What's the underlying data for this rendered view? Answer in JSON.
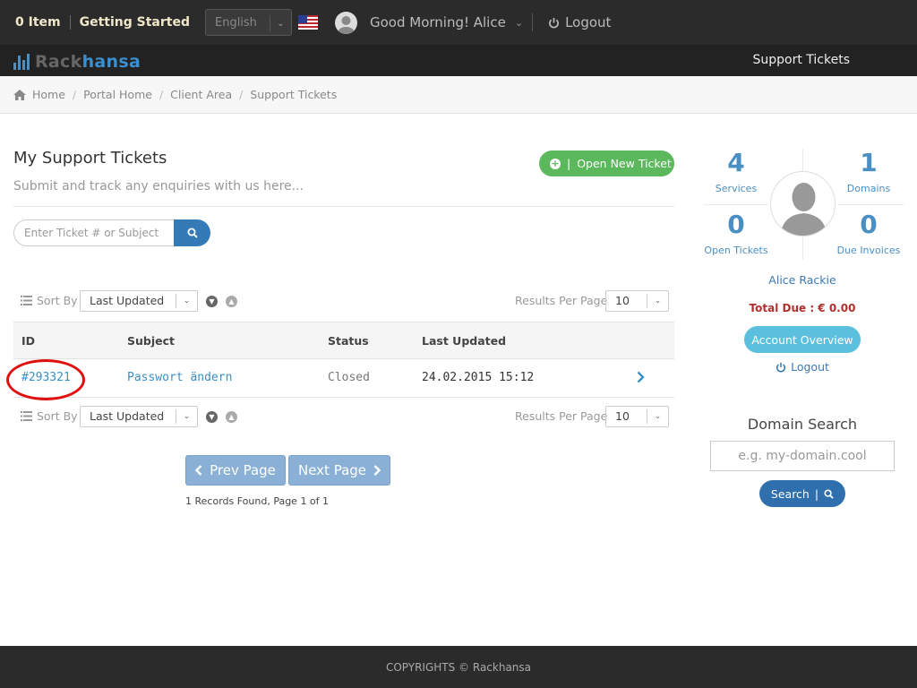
{
  "topbar": {
    "cart": "0 Item",
    "getting_started": "Getting Started",
    "language": "English",
    "greeting": "Good Morning! Alice",
    "logout": "Logout"
  },
  "brand": {
    "logo_part1": "Rack",
    "logo_part2": "hansa",
    "nav_active": "Support Tickets"
  },
  "breadcrumb": [
    "Home",
    "Portal Home",
    "Client Area",
    "Support Tickets"
  ],
  "main": {
    "title": "My Support Tickets",
    "subtitle": "Submit and track any enquiries with us here...",
    "open_ticket_label": "Open New Ticket",
    "search_placeholder": "Enter Ticket # or Subject",
    "sort_by_label": "Sort By",
    "sort_value": "Last Updated",
    "results_per_page_label": "Results Per Page",
    "results_per_page_value": "10",
    "columns": [
      "ID",
      "Subject",
      "Status",
      "Last Updated"
    ],
    "tickets": [
      {
        "id": "#293321",
        "subject": "Passwort ändern",
        "status": "Closed",
        "last_updated": "24.02.2015 15:12"
      }
    ],
    "prev_page": "Prev Page",
    "next_page": "Next Page",
    "records_text": "1 Records Found, Page 1 of 1"
  },
  "sidebar": {
    "stats": [
      {
        "value": "4",
        "label": "Services"
      },
      {
        "value": "1",
        "label": "Domains"
      },
      {
        "value": "0",
        "label": "Open Tickets"
      },
      {
        "value": "0",
        "label": "Due Invoices"
      }
    ],
    "name": "Alice Rackie",
    "total_due": "Total Due : € 0.00",
    "account_overview": "Account Overview",
    "logout": "Logout",
    "domain_search_title": "Domain Search",
    "domain_placeholder": "e.g. my-domain.cool",
    "search_button": "Search"
  },
  "footer": {
    "copyright": "COPYRIGHTS © Rackhansa"
  },
  "colors": {
    "accent_blue": "#4a8fc4",
    "green": "#5cb85c",
    "highlight_red": "#e01010"
  }
}
